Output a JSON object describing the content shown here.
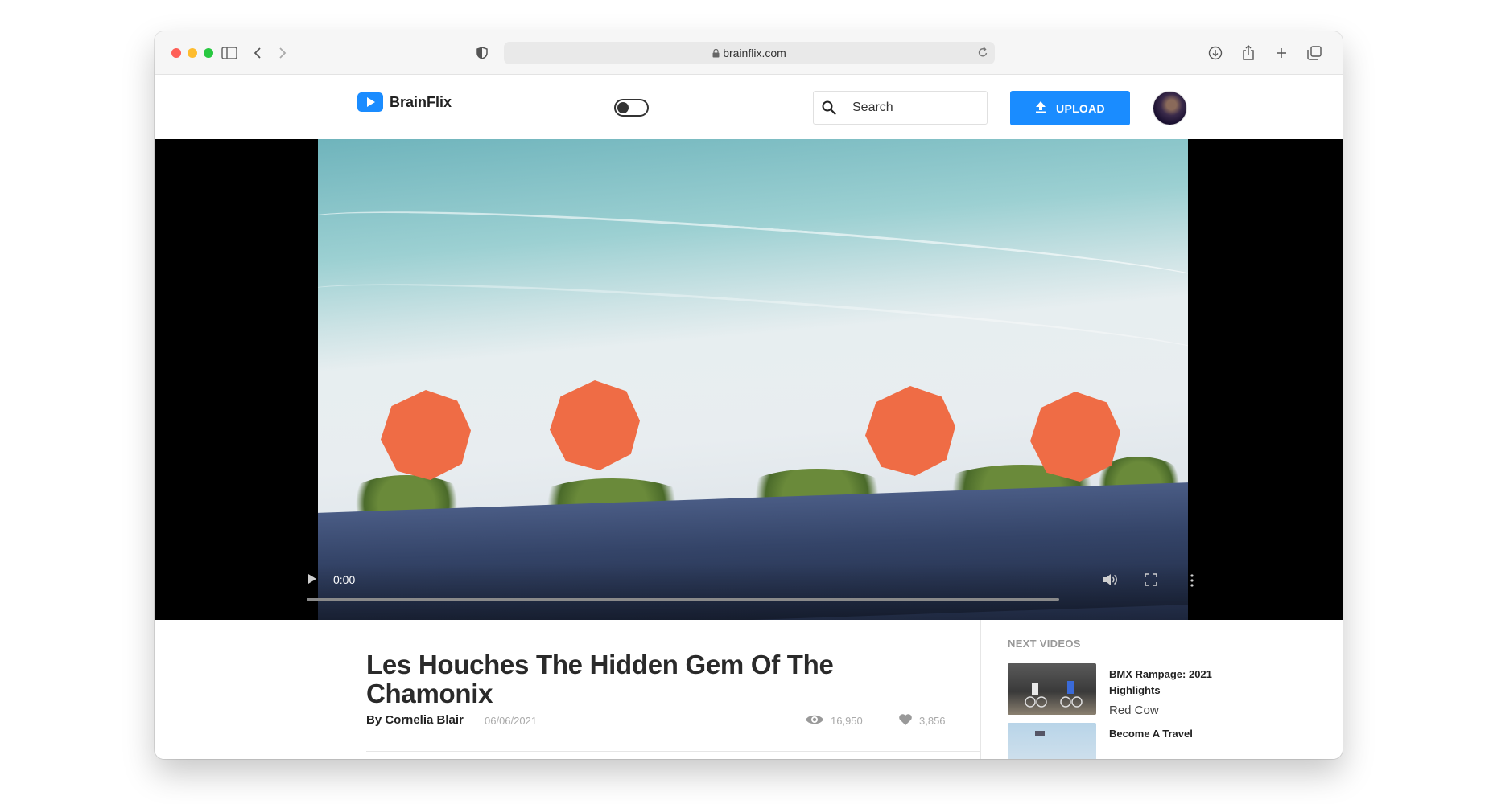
{
  "browser": {
    "url": "brainflix.com"
  },
  "header": {
    "logo_text": "BrainFlix",
    "search_placeholder": "Search",
    "upload_label": "UPLOAD"
  },
  "player": {
    "current_time": "0:00",
    "progress": 0
  },
  "video": {
    "title": "Les Houches The Hidden Gem Of The Chamonix",
    "author": "By Cornelia Blair",
    "date": "06/06/2021",
    "views": "16,950",
    "likes": "3,856"
  },
  "next_videos": {
    "heading": "NEXT VIDEOS",
    "items": [
      {
        "title": "BMX Rampage: 2021 Highlights",
        "channel": "Red Cow"
      },
      {
        "title": "Become A Travel",
        "channel": ""
      }
    ]
  },
  "colors": {
    "accent": "#1a8cff",
    "title_text": "#2a2a2a",
    "muted_text": "#aaaaaa"
  }
}
